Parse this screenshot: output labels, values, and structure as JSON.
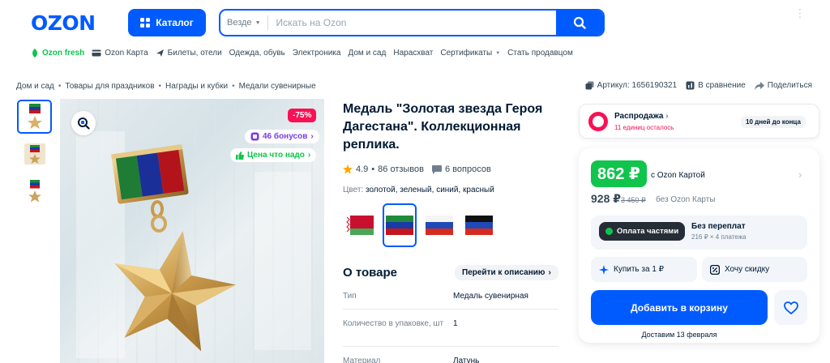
{
  "header": {
    "logo": "OZON",
    "catalog_label": "Каталог",
    "search": {
      "scope": "Везде",
      "placeholder": "Искать на Ozon"
    }
  },
  "topnav": [
    "Ozon fresh",
    "Ozon Карта",
    "Билеты, отели",
    "Одежда, обувь",
    "Электроника",
    "Дом и сад",
    "Нарасхват",
    "Сертификаты",
    "Стать продавцом"
  ],
  "breadcrumbs": [
    "Дом и сад",
    "Товары для праздников",
    "Награды и кубки",
    "Медали сувенирные"
  ],
  "meta": {
    "sku": "Артикул: 1656190321",
    "compare": "В сравнение",
    "share": "Поделиться"
  },
  "gallery": {
    "discount": "-75%",
    "bonus": "46 бонусов",
    "good_price": "Цена что надо"
  },
  "product": {
    "title": "Медаль \"Золотая звезда Героя Дагестана\". Коллекционная реплика.",
    "rating": "4.9",
    "reviews": "86 отзывов",
    "questions": "6 вопросов",
    "color_label": "Цвет:",
    "color_value": "золотой, зеленый, синий, красный",
    "swatches": [
      "belarus-flag",
      "dagestan-flag",
      "russia-flag",
      "dpr-flag"
    ]
  },
  "about": {
    "title": "О товаре",
    "link": "Перейти к описанию",
    "specs": [
      {
        "key": "Тип",
        "value": "Медаль сувенирная"
      },
      {
        "key": "Количество в упаковке, шт",
        "value": "1"
      },
      {
        "key": "Материал",
        "value": "Латунь"
      }
    ]
  },
  "sale": {
    "title": "Распродажа",
    "remaining": "11 единиц осталось",
    "days": "10 дней до конца"
  },
  "price": {
    "card_price": "862 ₽",
    "card_label": "с Ozon Картой",
    "normal_price": "928 ₽",
    "old_price": "3 450 ₽",
    "normal_label": "без Ozon Карты"
  },
  "installment": {
    "button": "Оплата частями",
    "title": "Без переплат",
    "subtitle": "216 ₽ × 4 платежа"
  },
  "actions": {
    "buy_for_1": "Купить за 1 ₽",
    "want_discount": "Хочу скидку",
    "add_to_cart": "Добавить в корзину",
    "delivery": "Доставим 13 февраля"
  },
  "colors": {
    "brand_blue": "#005bff",
    "sale_pink": "#f91155",
    "green": "#10c44c",
    "bonus_purple": "#7a3be7"
  }
}
